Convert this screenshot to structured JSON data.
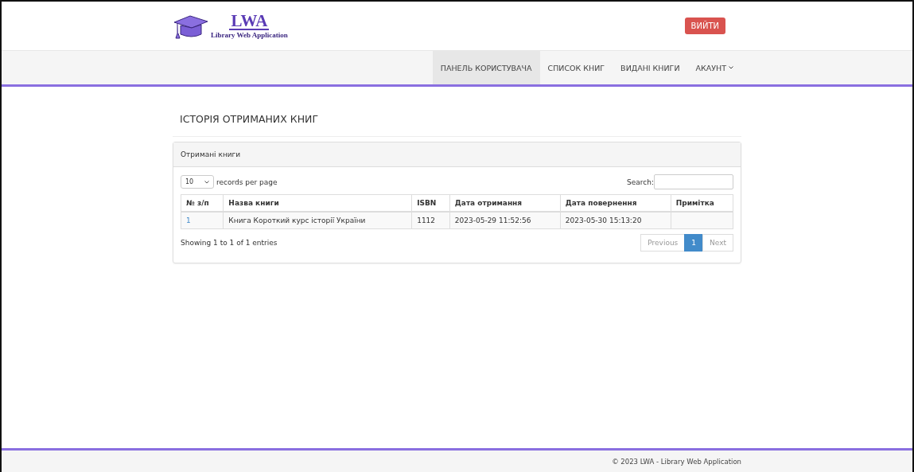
{
  "logo": {
    "title": "LWA",
    "subtitle": "Library Web Application"
  },
  "logout_button": "ВИЙТИ",
  "nav": [
    {
      "label": "ПАНЕЛЬ КОРИСТУВАЧА",
      "selected": true,
      "dropdown": false
    },
    {
      "label": "СПИСОК КНИГ",
      "selected": false,
      "dropdown": false
    },
    {
      "label": "ВИДАНІ КНИГИ",
      "selected": false,
      "dropdown": false
    },
    {
      "label": "АКАУНТ",
      "selected": false,
      "dropdown": true
    }
  ],
  "page_title": "ІСТОРІЯ ОТРИМАНИХ КНИГ",
  "panel": {
    "heading": "Отримані книги",
    "page_size": {
      "value": "10",
      "label": "records per page"
    },
    "search": {
      "label": "Search:"
    },
    "table": {
      "columns": [
        "№ з/п",
        "Назва книги",
        "ISBN",
        "Дата отримання",
        "Дата повернення",
        "Примітка"
      ],
      "rows": [
        [
          "1",
          "Книга Короткий курс історії України",
          "1112",
          "2023-05-29 11:52:56",
          "2023-05-30 15:13:20",
          ""
        ]
      ]
    },
    "info": "Showing 1 to 1 of 1 entries",
    "pagination": [
      {
        "label": "Previous",
        "selected": false
      },
      {
        "label": "1",
        "selected": true
      },
      {
        "label": "Next",
        "selected": false
      }
    ]
  },
  "footer": "© 2023 LWA - Library Web Application"
}
